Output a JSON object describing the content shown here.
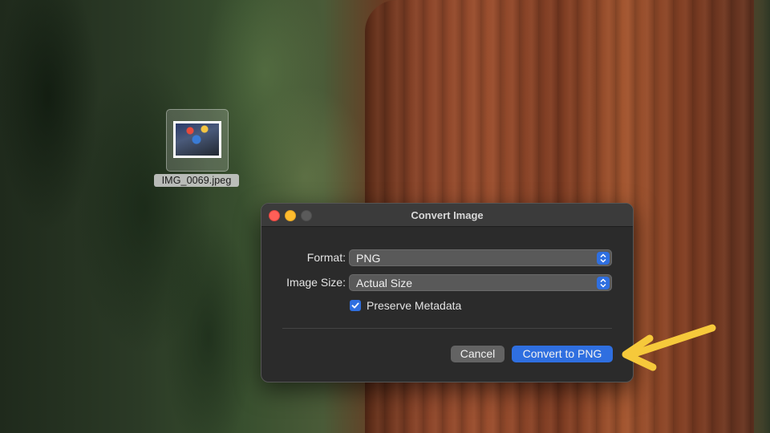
{
  "desktop": {
    "file_icon": {
      "name": "IMG_0069.jpeg",
      "icon": "image-thumbnail-icon"
    }
  },
  "dialog": {
    "title": "Convert Image",
    "window_controls": [
      "close-icon",
      "minimize-icon",
      "zoom-icon"
    ],
    "format": {
      "label": "Format:",
      "value": "PNG"
    },
    "image_size": {
      "label": "Image Size:",
      "value": "Actual Size"
    },
    "preserve_metadata": {
      "label": "Preserve Metadata",
      "checked": true
    },
    "buttons": {
      "cancel": "Cancel",
      "primary": "Convert to PNG"
    }
  },
  "annotation": {
    "icon": "arrow-left-icon",
    "color": "#f6c93b"
  },
  "colors": {
    "accent": "#2f6fe0",
    "dialog_bg": "#2b2b2b",
    "close": "#fe5f57",
    "minimize": "#febc2e"
  }
}
